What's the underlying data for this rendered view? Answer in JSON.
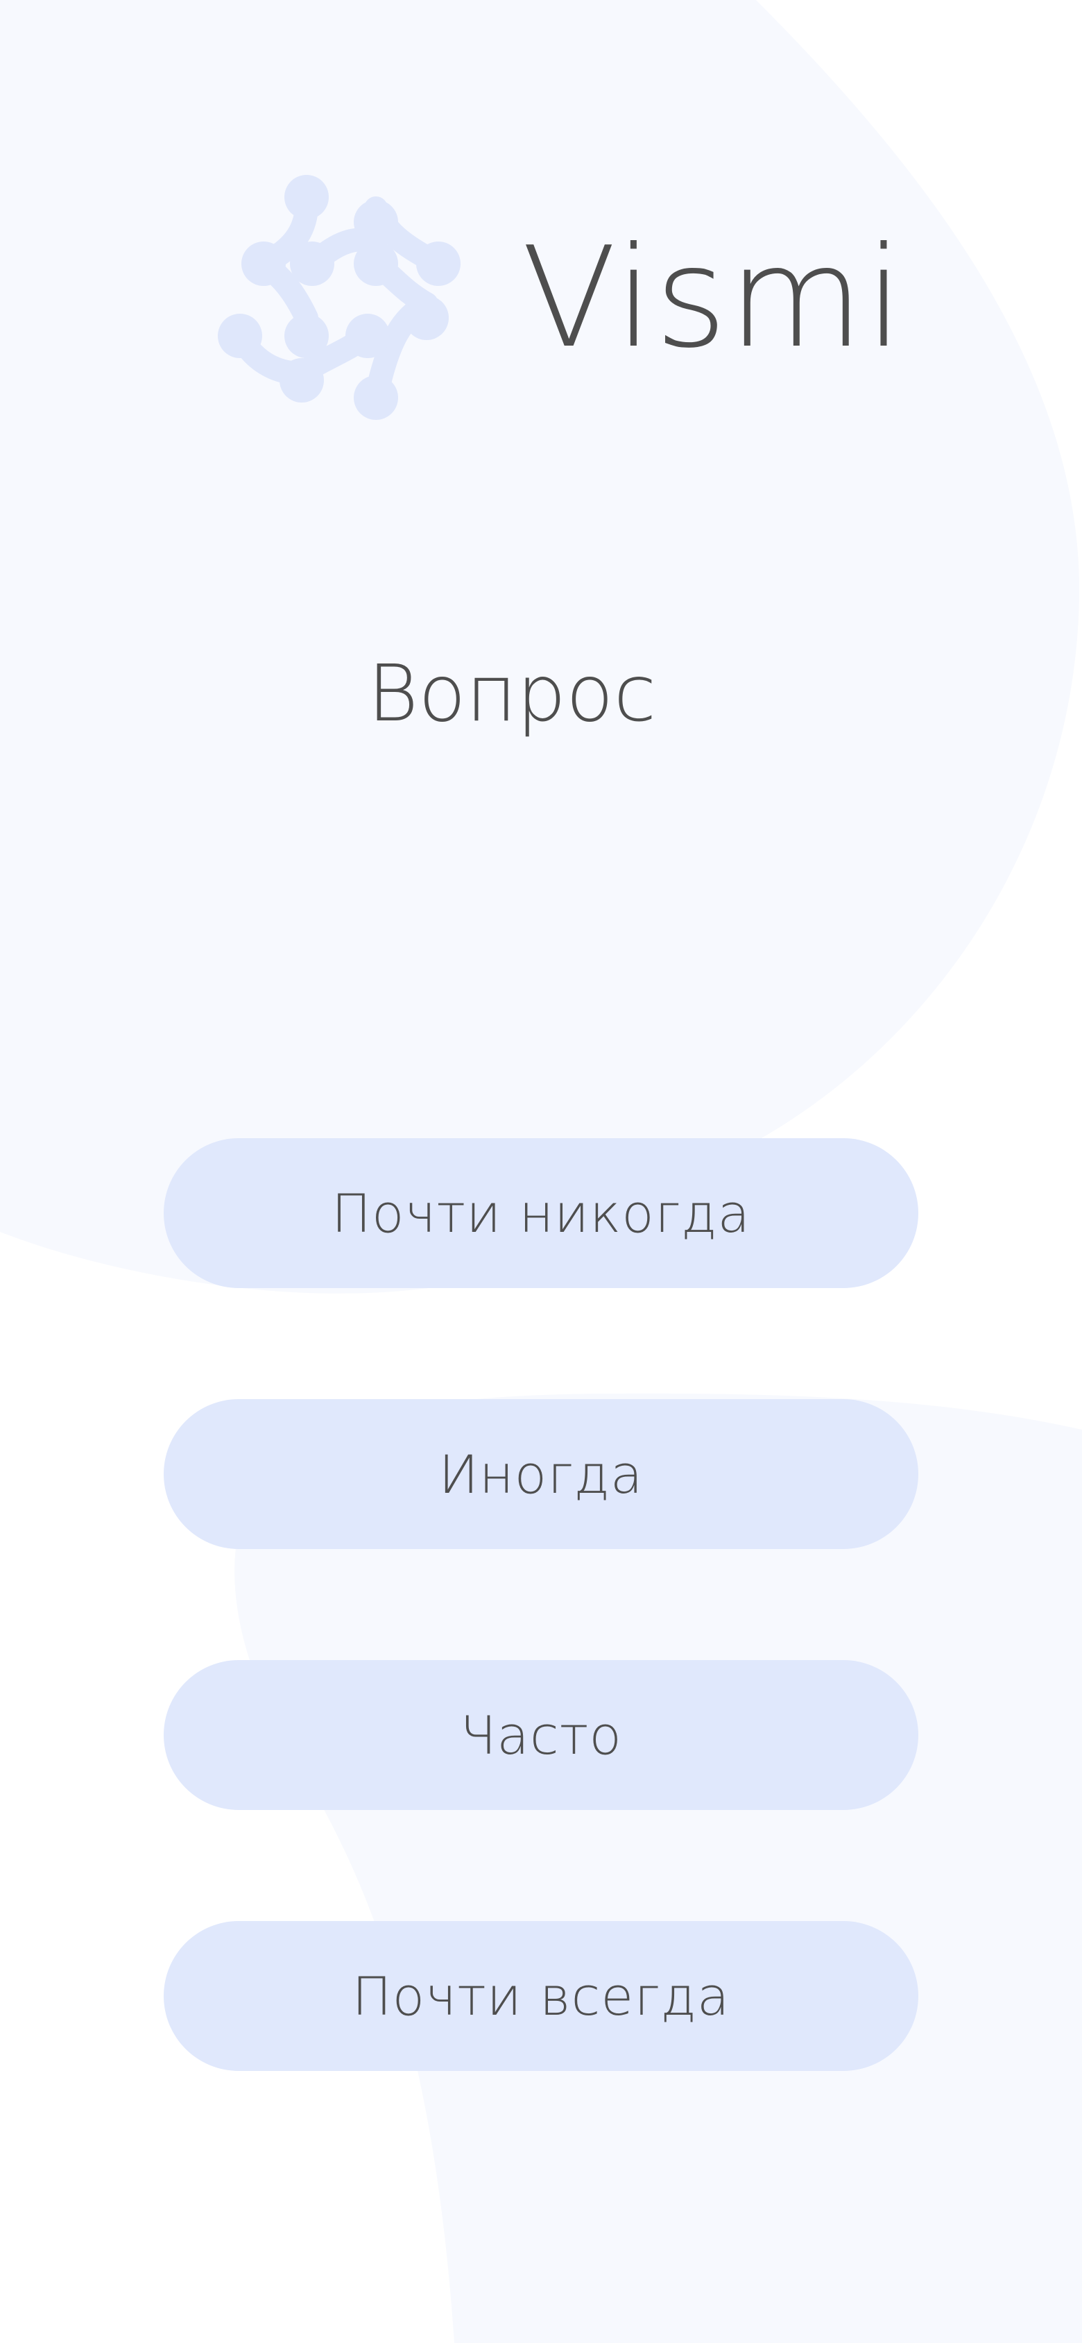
{
  "app": {
    "name": "Vismi",
    "logo_icon": "molecule-swirl-icon"
  },
  "question": {
    "title": "Вопрос"
  },
  "answers": [
    {
      "label": "Почти никогда"
    },
    {
      "label": "Иногда"
    },
    {
      "label": "Часто"
    },
    {
      "label": "Почти всегда"
    }
  ],
  "colors": {
    "background": "#ffffff",
    "background_blob": "#f7f9fe",
    "button_fill": "#e0e8fc",
    "logo_fill": "#dfe7fb",
    "text": "#4e4e4e"
  }
}
